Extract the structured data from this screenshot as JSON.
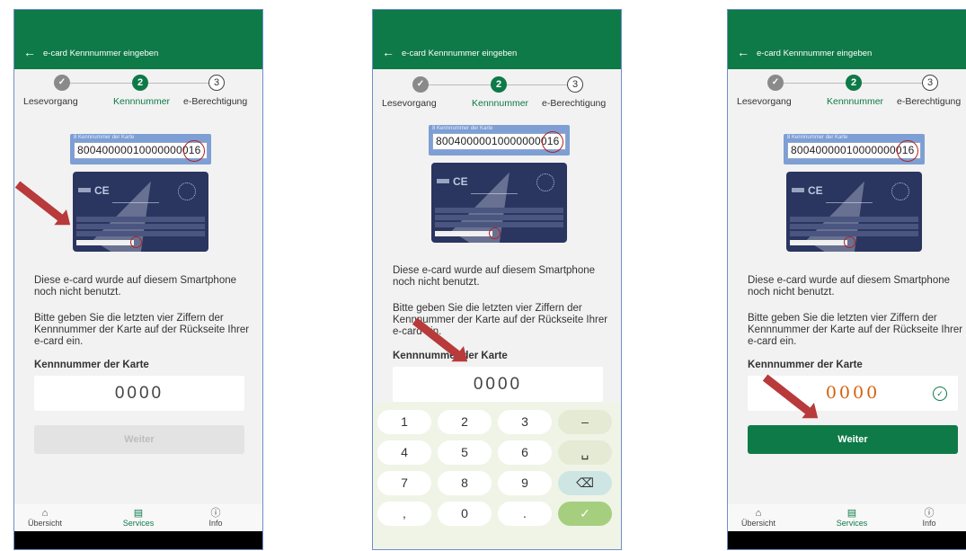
{
  "appbar": {
    "back_icon": "back-arrow-icon",
    "title": "e-card Kennnummer eingeben"
  },
  "steps": {
    "step1": {
      "icon": "checkmark-icon",
      "label": "Lesevorgang"
    },
    "step2": {
      "number": "2",
      "label": "Kennnummer"
    },
    "step3": {
      "number": "3",
      "label": "e-Berechtigung"
    }
  },
  "card": {
    "field_label": "8 Kennnummer der Karte",
    "number": "80040000010000000016"
  },
  "info": {
    "not_used": "Diese e-card wurde auf diesem Smartphone noch nicht benutzt.",
    "instruction": "Bitte geben Sie die letzten vier Ziffern der Kennnummer der Karte auf der Rückseite Ihrer e-card ein.",
    "field_label": "Kennnummer der Karte",
    "pin_placeholder": "0000",
    "pin_value": "0000"
  },
  "button": {
    "label": "Weiter"
  },
  "bottomnav": [
    {
      "icon": "home-icon",
      "label": "Übersicht"
    },
    {
      "icon": "services-icon",
      "label": "Services"
    },
    {
      "icon": "info-icon",
      "label": "Info"
    }
  ],
  "keypad": {
    "keys": [
      "1",
      "2",
      "3",
      "–",
      "4",
      "5",
      "6",
      "␣",
      "7",
      "8",
      "9",
      "⌫",
      ",",
      "0",
      ".",
      "✓"
    ]
  },
  "colors": {
    "primary": "#0e7a47",
    "annotation_red": "#b83a3a",
    "pin_orange": "#d4620b"
  }
}
